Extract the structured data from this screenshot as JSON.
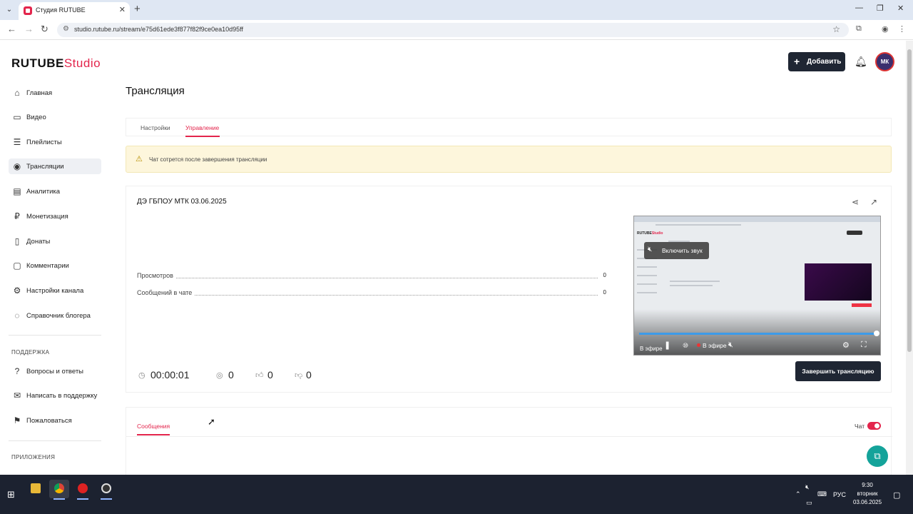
{
  "browser": {
    "tab_title": "Студия RUTUBE",
    "url": "studio.rutube.ru/stream/e75d61ede3f877f82f9ce0ea10d95ff"
  },
  "header": {
    "logo_rutube": "RUTUBE",
    "logo_studio": "Studio",
    "add_label": "Добавить",
    "avatar_text": "МК"
  },
  "sidebar": {
    "items": [
      {
        "label": "Главная",
        "icon": "home-icon"
      },
      {
        "label": "Видео",
        "icon": "video-icon"
      },
      {
        "label": "Плейлисты",
        "icon": "playlist-icon"
      },
      {
        "label": "Трансляции",
        "icon": "broadcast-icon"
      },
      {
        "label": "Аналитика",
        "icon": "analytics-icon"
      },
      {
        "label": "Монетизация",
        "icon": "monetization-icon"
      },
      {
        "label": "Донаты",
        "icon": "donate-icon"
      },
      {
        "label": "Комментарии",
        "icon": "comments-icon"
      },
      {
        "label": "Настройки канала",
        "icon": "gear-icon"
      },
      {
        "label": "Справочник блогера",
        "icon": "help-circle-icon"
      }
    ],
    "support_heading": "ПОДДЕРЖКА",
    "support_items": [
      {
        "label": "Вопросы и ответы",
        "icon": "question-icon"
      },
      {
        "label": "Написать в поддержку",
        "icon": "mail-icon"
      },
      {
        "label": "Пожаловаться",
        "icon": "flag-icon"
      }
    ],
    "apps_heading": "ПРИЛОЖЕНИЯ"
  },
  "main": {
    "title": "Трансляция",
    "tabs": [
      {
        "label": "Настройки"
      },
      {
        "label": "Управление"
      }
    ],
    "alert_text": "Чат сотрется после завершения трансляции",
    "stream": {
      "title": "ДЭ ГБПОУ МТК 03.06.2025",
      "stats": [
        {
          "label": "Просмотров",
          "value": "0"
        },
        {
          "label": "Сообщений в чате",
          "value": "0"
        }
      ],
      "timer": "00:00:01",
      "viewers": "0",
      "likes": "0",
      "dislikes": "0",
      "end_button": "Завершить трансляцию",
      "player": {
        "unmute_label": "Включить звук",
        "live_label": "В эфире",
        "progress_percent": 100
      }
    },
    "chat": {
      "tab_label": "Сообщения",
      "toggle_label": "Чат",
      "enabled": true
    }
  },
  "taskbar": {
    "lang": "РУС",
    "time": "9:30",
    "day": "вторник",
    "date": "03.06.2025"
  },
  "colors": {
    "accent": "#e3254c",
    "dark_button": "#1f2633",
    "alert_bg": "#fdf6dc",
    "help_button": "#14a39a"
  }
}
